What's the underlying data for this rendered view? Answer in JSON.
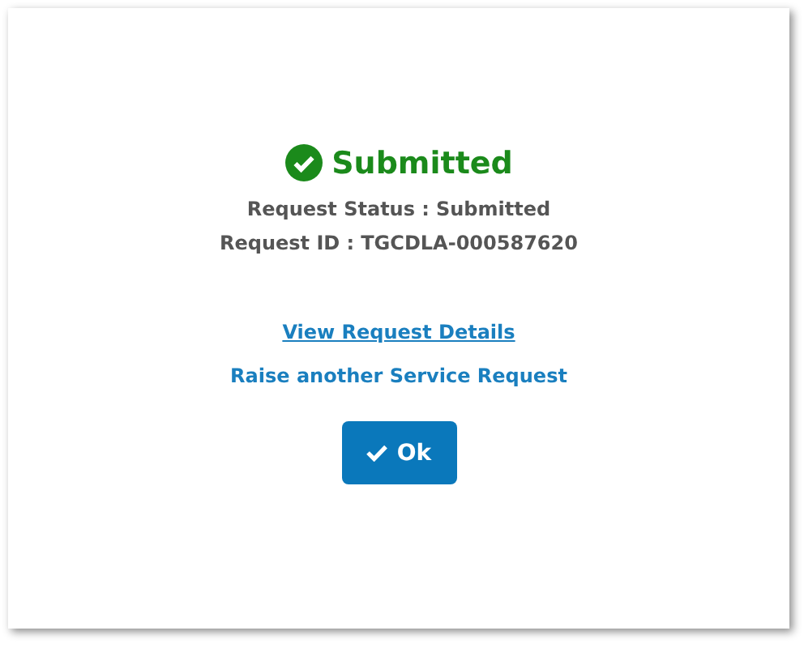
{
  "status": {
    "title": "Submitted"
  },
  "details": [
    {
      "label": "Request Status :",
      "value": "Submitted"
    },
    {
      "label": "Request ID :",
      "value": "TGCDLA-000587620"
    }
  ],
  "links": [
    {
      "label": "View Request Details",
      "kind": "underlined"
    },
    {
      "label": "Raise another Service Request",
      "kind": "plain"
    }
  ],
  "ok_button": {
    "label": "Ok"
  }
}
